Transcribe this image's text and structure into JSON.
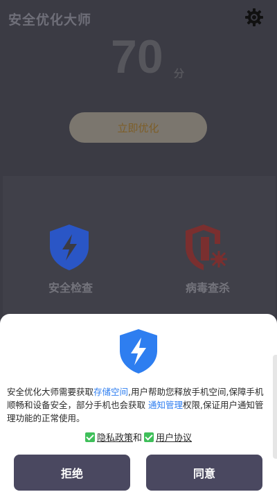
{
  "app": {
    "title": "安全优化大师",
    "icon_settings": "gear-icon",
    "score": {
      "value": "70",
      "unit": "分"
    },
    "optimize_button": "立即优化",
    "features": [
      {
        "label": "安全检查",
        "icon": "shield-lightning-icon"
      },
      {
        "label": "病毒查杀",
        "icon": "shield-virus-icon"
      }
    ]
  },
  "dialog": {
    "icon": "shield-lightning-icon",
    "text": {
      "part1": "安全优化大师需要获取",
      "link1": "存储空间",
      "part2": ",用户帮助您释放手机空间,保障手机顺畅和设备安全，部分手机也会获取 ",
      "link2": "通知管理",
      "part3": "权限,保证用户通知管理功能的正常使用。"
    },
    "privacy_label": "隐私政策",
    "and_text": "和",
    "agreement_label": "用户协议",
    "reject_button": "拒绝",
    "accept_button": "同意"
  },
  "colors": {
    "background": "#3b3b44",
    "accent_blue": "#2e7ef0",
    "shield_red": "#c0392b",
    "check_green": "#3fbf5a",
    "button": "#4a4860"
  }
}
